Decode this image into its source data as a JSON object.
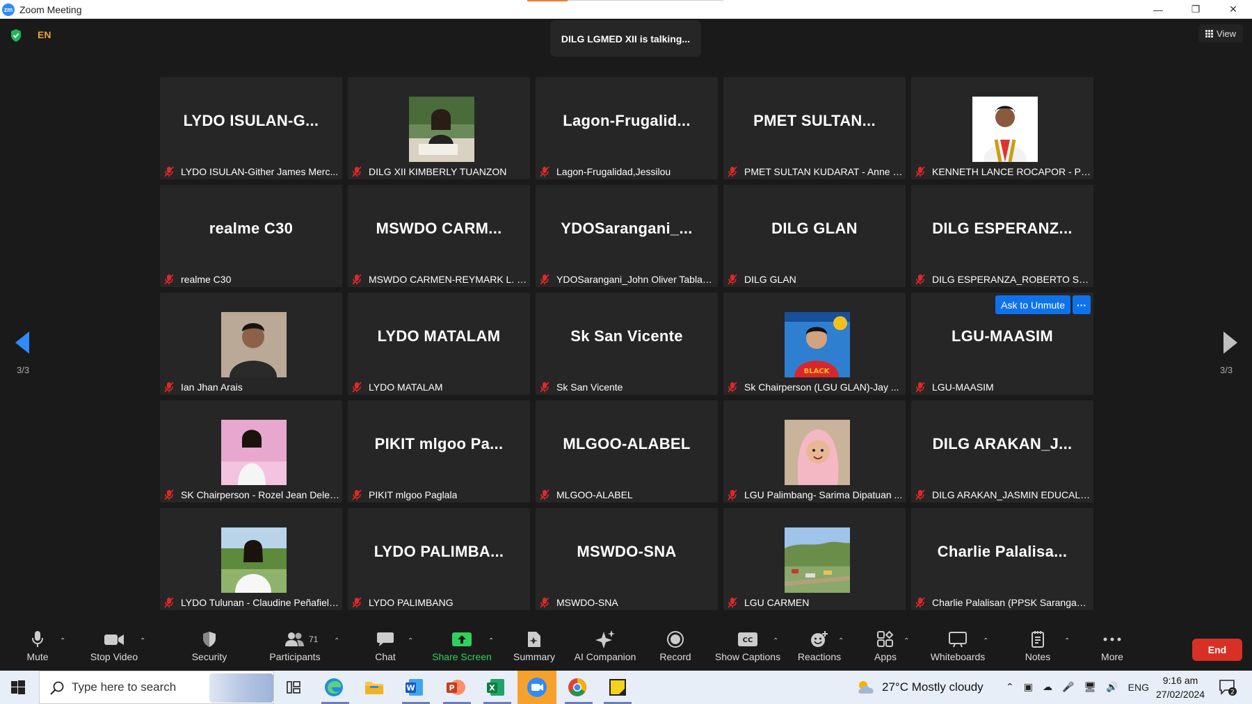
{
  "window": {
    "title": "Zoom Meeting",
    "app_icon_text": "zm"
  },
  "header": {
    "language": "EN",
    "talking": "DILG LGMED XII is talking...",
    "view_label": "View"
  },
  "pagination": {
    "left_label": "3/3",
    "right_label": "3/3"
  },
  "tiles": [
    {
      "big": "LYDO ISULAN-G...",
      "name": "LYDO ISULAN-Gither James Merc...",
      "photo": null
    },
    {
      "big": "",
      "name": "DILG XII KIMBERLY TUANZON",
      "photo": "woman-at-desk"
    },
    {
      "big": "Lagon-Frugalid...",
      "name": "Lagon-Frugalidad,Jessilou",
      "photo": null
    },
    {
      "big": "PMET SULTAN...",
      "name": "PMET SULTAN KUDARAT - Anne J...",
      "photo": null
    },
    {
      "big": "",
      "name": "KENNETH LANCE ROCAPOR - PPS...",
      "photo": "man-formal"
    },
    {
      "big": "realme C30",
      "name": "realme C30",
      "photo": null
    },
    {
      "big": "MSWDO CARM...",
      "name": "MSWDO CARMEN-REYMARK L. D...",
      "photo": null
    },
    {
      "big": "YDOSarangani_...",
      "name": "YDOSarangani_John Oliver Tablaz...",
      "photo": null
    },
    {
      "big": "DILG GLAN",
      "name": "DILG GLAN",
      "photo": null
    },
    {
      "big": "DILG ESPERANZ...",
      "name": "DILG ESPERANZA_ROBERTO S. PE...",
      "photo": null
    },
    {
      "big": "",
      "name": "Ian Jhan Arais",
      "photo": "man-portrait"
    },
    {
      "big": "LYDO MATALAM",
      "name": "LYDO MATALAM",
      "photo": null
    },
    {
      "big": "Sk San Vicente",
      "name": "Sk San Vicente",
      "photo": null
    },
    {
      "big": "",
      "name": "Sk Chairperson (LGU GLAN)-Jay ...",
      "photo": "sk-chairman"
    },
    {
      "big": "LGU-MAASIM",
      "name": "LGU-MAASIM",
      "photo": null,
      "ask_unmute": "Ask to Unmute",
      "more": "···"
    },
    {
      "big": "",
      "name": "SK Chairperson - Rozel Jean Deles...",
      "photo": "woman-pink"
    },
    {
      "big": "PIKIT mlgoo Pa...",
      "name": "PIKIT mlgoo Paglala",
      "photo": null
    },
    {
      "big": "MLGOO-ALABEL",
      "name": "MLGOO-ALABEL",
      "photo": null
    },
    {
      "big": "",
      "name": "LGU Palimbang- Sarima Dipatuan ...",
      "photo": "woman-hijab"
    },
    {
      "big": "DILG ARAKAN_J...",
      "name": "DILG ARAKAN_JASMIN EDUCALAN",
      "photo": null
    },
    {
      "big": "",
      "name": "LYDO Tulunan - Claudine Peñafiel ...",
      "photo": "woman-outdoor"
    },
    {
      "big": "LYDO PALIMBA...",
      "name": "LYDO PALIMBANG",
      "photo": null
    },
    {
      "big": "MSWDO-SNA",
      "name": "MSWDO-SNA",
      "photo": null
    },
    {
      "big": "",
      "name": "LGU CARMEN",
      "photo": "landscape"
    },
    {
      "big": "Charlie Palalisa...",
      "name": "Charlie Palalisan (PPSK Sarangani ...",
      "photo": null
    }
  ],
  "toolbar": {
    "mute": "Mute",
    "stop_video": "Stop Video",
    "security": "Security",
    "participants": "Participants",
    "participants_count": "71",
    "chat": "Chat",
    "share_screen": "Share Screen",
    "summary": "Summary",
    "ai_companion": "AI Companion",
    "record": "Record",
    "show_captions": "Show Captions",
    "reactions": "Reactions",
    "apps": "Apps",
    "whiteboards": "Whiteboards",
    "notes": "Notes",
    "more": "More",
    "end": "End"
  },
  "taskbar": {
    "search_placeholder": "Type here to search",
    "weather": "27°C  Mostly cloudy",
    "lang": "ENG",
    "time": "9:16 am",
    "date": "27/02/2024",
    "notifications": "2"
  },
  "colors": {
    "accent_blue": "#0e72ed",
    "share_green": "#2ed15f",
    "end_red": "#d93025",
    "muted_red": "#e02828"
  }
}
